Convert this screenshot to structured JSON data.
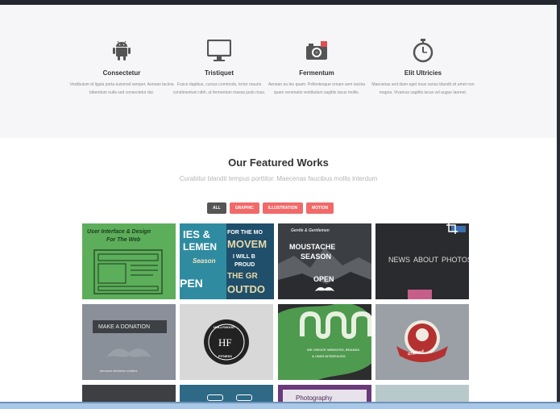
{
  "services": [
    {
      "icon": "android-icon",
      "title": "Consectetur",
      "desc": "Vestibulum id ligula porta euismod semper. Aenean lacinia bibendum nulla sed consectetur dui."
    },
    {
      "icon": "monitor-icon",
      "title": "Tristiquet",
      "desc": "Fusce dapibus, cursus commodo, tortor mauris condimentum nibh, ut fermentum massa justo risus."
    },
    {
      "icon": "camera-icon",
      "title": "Fermentum",
      "desc": "Aenean eu leo quam. Pellentesque ornare sem lacinia quam venenatis vestibulum sagittis lacus mollis."
    },
    {
      "icon": "stopwatch-icon",
      "title": "Elit Ultricies",
      "desc": "Maecenas sed diam eget risus varius blandit sit amet non magna. Vivamus sagittis lacus vel augue laoreet."
    }
  ],
  "works": {
    "title": "Our Featured Works",
    "subtitle": "Curabitur blandit tempus porttitor. Maecenas faucibus mollis interdum",
    "filters": [
      "ALL",
      "GRAPHIC",
      "ILLUSTRATION",
      "MOTION"
    ],
    "tiles": [
      {
        "text1": "User Interface & Design",
        "text2": "For The Web"
      },
      {
        "text1": "IES &",
        "text2": "LEMEN",
        "text3": "Season",
        "text4": "PEN"
      },
      {
        "text1": "FOR THE MO",
        "text2": "MOVEM",
        "text3": "I WILL B",
        "text4": "PROUD",
        "text5": "THE GR",
        "text6": "OUTDO"
      },
      {
        "text1": "Gentle & Gentlemen",
        "text2": "MOUSTACHE",
        "text3": "SEASON",
        "text4": "OPEN"
      },
      {
        "text1": "NEWS",
        "text2": "ABOUT",
        "text3": "PHOTOS"
      },
      {
        "text1": "MAKE A DONATION",
        "text2": "because kindness matters"
      },
      {
        "text1": "HF",
        "text2": "HOLLYWOOD",
        "text3": "FITNESS"
      },
      {
        "text1": "WE CREATE WEBSITES, BRANDS",
        "text2": "& USER INTERFACES"
      },
      {
        "text1": "crafted"
      }
    ],
    "bottom_partial": "Photography"
  }
}
